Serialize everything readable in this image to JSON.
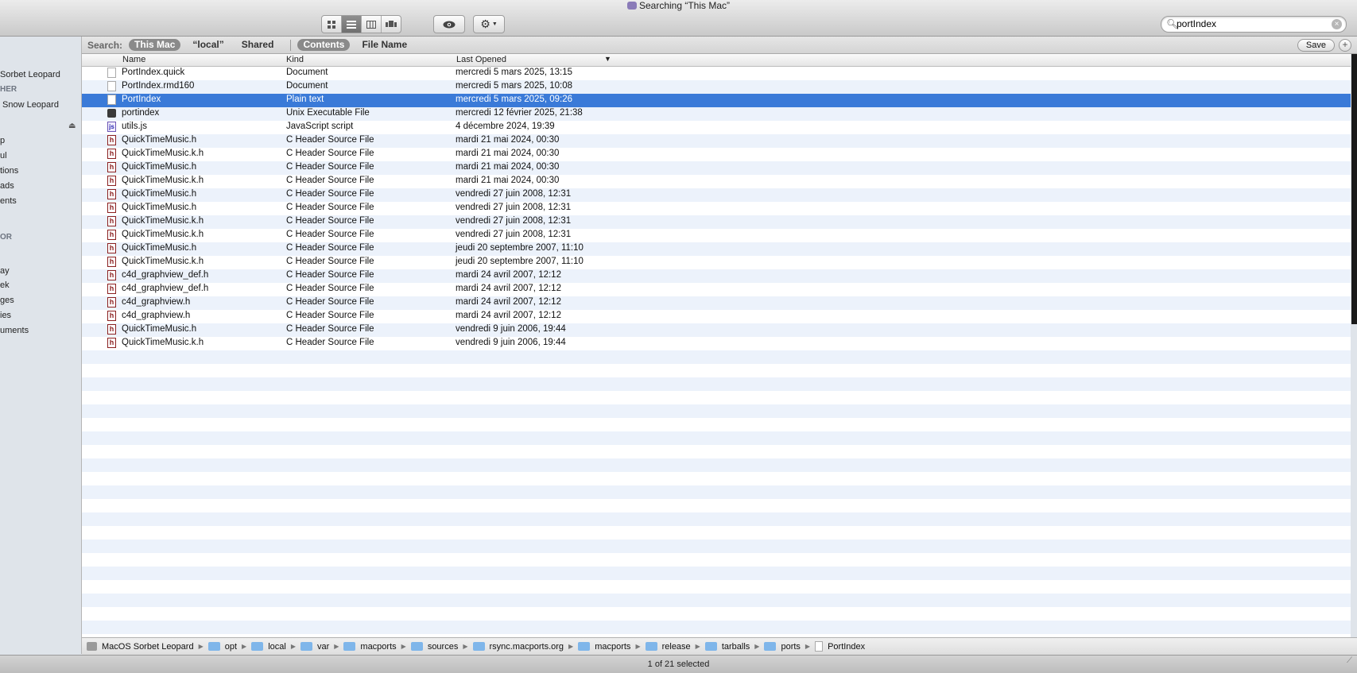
{
  "window": {
    "title": "Searching “This Mac”"
  },
  "toolbar": {
    "view_buttons": [
      "icon-view",
      "list-view",
      "column-view",
      "coverflow-view"
    ],
    "search_value": "portIndex"
  },
  "sidebar": {
    "items": [
      {
        "label": "Sorbet Leopard"
      },
      {
        "label": "HER"
      },
      {
        "label": "Snow Leopard"
      },
      {
        "label": "p"
      },
      {
        "label": "ul"
      },
      {
        "label": "tions"
      },
      {
        "label": "ads"
      },
      {
        "label": "ents"
      },
      {
        "label": "OR"
      },
      {
        "label": "ay"
      },
      {
        "label": "ek"
      },
      {
        "label": "ges"
      },
      {
        "label": "ies"
      },
      {
        "label": "uments"
      }
    ]
  },
  "scope": {
    "label": "Search:",
    "this_mac": "This Mac",
    "local": "“local”",
    "shared": "Shared",
    "contents": "Contents",
    "file_name": "File Name",
    "save": "Save",
    "plus": "+"
  },
  "columns": {
    "name": "Name",
    "kind": "Kind",
    "last_opened": "Last Opened"
  },
  "files": [
    {
      "name": "PortIndex.quick",
      "kind": "Document",
      "date": "mercredi 5 mars 2025, 13:15",
      "icon": "doc"
    },
    {
      "name": "PortIndex.rmd160",
      "kind": "Document",
      "date": "mercredi 5 mars 2025, 10:08",
      "icon": "doc"
    },
    {
      "name": "PortIndex",
      "kind": "Plain text",
      "date": "mercredi 5 mars 2025, 09:26",
      "icon": "doc"
    },
    {
      "name": "portindex",
      "kind": "Unix Executable File",
      "date": "mercredi 12 février 2025, 21:38",
      "icon": "exe"
    },
    {
      "name": "utils.js",
      "kind": "JavaScript script",
      "date": "4 décembre 2024, 19:39",
      "icon": "js"
    },
    {
      "name": "QuickTimeMusic.h",
      "kind": "C Header Source File",
      "date": "mardi 21 mai 2024, 00:30",
      "icon": "hdr"
    },
    {
      "name": "QuickTimeMusic.k.h",
      "kind": "C Header Source File",
      "date": "mardi 21 mai 2024, 00:30",
      "icon": "hdr"
    },
    {
      "name": "QuickTimeMusic.h",
      "kind": "C Header Source File",
      "date": "mardi 21 mai 2024, 00:30",
      "icon": "hdr"
    },
    {
      "name": "QuickTimeMusic.k.h",
      "kind": "C Header Source File",
      "date": "mardi 21 mai 2024, 00:30",
      "icon": "hdr"
    },
    {
      "name": "QuickTimeMusic.h",
      "kind": "C Header Source File",
      "date": "vendredi 27 juin 2008, 12:31",
      "icon": "hdr"
    },
    {
      "name": "QuickTimeMusic.h",
      "kind": "C Header Source File",
      "date": "vendredi 27 juin 2008, 12:31",
      "icon": "hdr"
    },
    {
      "name": "QuickTimeMusic.k.h",
      "kind": "C Header Source File",
      "date": "vendredi 27 juin 2008, 12:31",
      "icon": "hdr"
    },
    {
      "name": "QuickTimeMusic.k.h",
      "kind": "C Header Source File",
      "date": "vendredi 27 juin 2008, 12:31",
      "icon": "hdr"
    },
    {
      "name": "QuickTimeMusic.h",
      "kind": "C Header Source File",
      "date": "jeudi 20 septembre 2007, 11:10",
      "icon": "hdr"
    },
    {
      "name": "QuickTimeMusic.k.h",
      "kind": "C Header Source File",
      "date": "jeudi 20 septembre 2007, 11:10",
      "icon": "hdr"
    },
    {
      "name": "c4d_graphview_def.h",
      "kind": "C Header Source File",
      "date": "mardi 24 avril 2007, 12:12",
      "icon": "hdr"
    },
    {
      "name": "c4d_graphview_def.h",
      "kind": "C Header Source File",
      "date": "mardi 24 avril 2007, 12:12",
      "icon": "hdr"
    },
    {
      "name": "c4d_graphview.h",
      "kind": "C Header Source File",
      "date": "mardi 24 avril 2007, 12:12",
      "icon": "hdr"
    },
    {
      "name": "c4d_graphview.h",
      "kind": "C Header Source File",
      "date": "mardi 24 avril 2007, 12:12",
      "icon": "hdr"
    },
    {
      "name": "QuickTimeMusic.h",
      "kind": "C Header Source File",
      "date": "vendredi 9 juin 2006, 19:44",
      "icon": "hdr"
    },
    {
      "name": "QuickTimeMusic.k.h",
      "kind": "C Header Source File",
      "date": "vendredi 9 juin 2006, 19:44",
      "icon": "hdr"
    }
  ],
  "selected_index": 2,
  "path": [
    {
      "label": "MacOS Sorbet Leopard",
      "icon": "disk"
    },
    {
      "label": "opt",
      "icon": "folder"
    },
    {
      "label": "local",
      "icon": "folder"
    },
    {
      "label": "var",
      "icon": "folder"
    },
    {
      "label": "macports",
      "icon": "folder"
    },
    {
      "label": "sources",
      "icon": "folder"
    },
    {
      "label": "rsync.macports.org",
      "icon": "folder"
    },
    {
      "label": "macports",
      "icon": "folder"
    },
    {
      "label": "release",
      "icon": "folder"
    },
    {
      "label": "tarballs",
      "icon": "folder"
    },
    {
      "label": "ports",
      "icon": "folder"
    },
    {
      "label": "PortIndex",
      "icon": "document"
    }
  ],
  "status": "1 of 21 selected"
}
